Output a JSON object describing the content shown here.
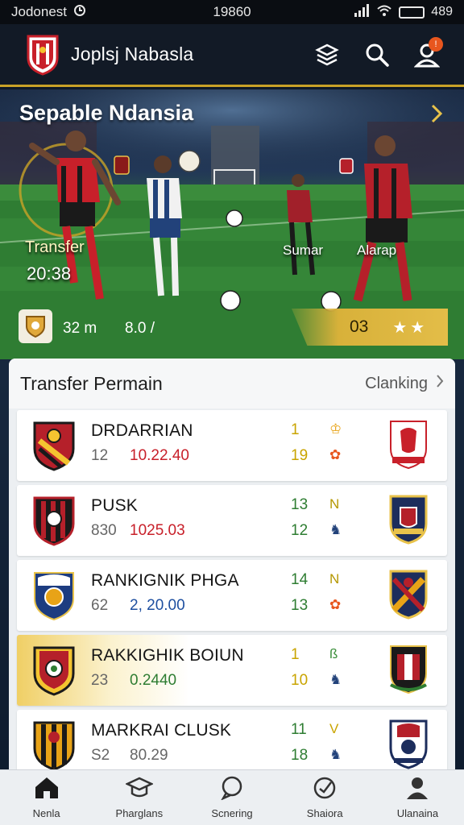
{
  "status_bar": {
    "carrier": "Jodonest",
    "time": "19860",
    "right_text": "489",
    "icons": [
      "signal-icon",
      "wifi-icon",
      "battery-icon"
    ]
  },
  "app_bar": {
    "title": "Joplsj Nabasla",
    "notification_count": "!",
    "icons": [
      "club-crest-icon",
      "box-icon",
      "search-icon",
      "profile-icon"
    ]
  },
  "hero": {
    "title": "Sepable Ndansia",
    "label_transfer": "Transfer",
    "label_time": "20:38",
    "label_player_a": "Sumar",
    "label_player_b": "Alarap",
    "stat_one": "32 m",
    "stat_two": "8.0 /",
    "score": "03",
    "stars": "★★"
  },
  "transfer_card": {
    "title": "Transfer Permain",
    "link": "Clanking",
    "rows": [
      {
        "name": "DRDARRIAN",
        "sub": "12",
        "price": "10.22.40",
        "s1": "1",
        "s2": "19",
        "mark1": "♔",
        "mark2": "✿",
        "price_color": "#c8202a",
        "s_color": "#c9a400",
        "m1_color": "#e8a317",
        "m2_color": "#e8561e"
      },
      {
        "name": "PUSK",
        "sub": "830",
        "price": "1025.03",
        "s1": "13",
        "s2": "12",
        "mark1": "N",
        "mark2": "♞",
        "price_color": "#c8202a",
        "s_color": "#2e7d32",
        "m1_color": "#b49700",
        "m2_color": "#22427a"
      },
      {
        "name": "RANKIGNIK PHGA",
        "sub": "62",
        "price": "2, 20.00",
        "s1": "14",
        "s2": "13",
        "mark1": "N",
        "mark2": "✿",
        "price_color": "#1e4fa0",
        "s_color": "#2e7d32",
        "m1_color": "#b49700",
        "m2_color": "#e8561e"
      },
      {
        "name": "RAKKIGHIK BOIUN",
        "sub": "23",
        "price": "0.2440",
        "s1": "1",
        "s2": "10",
        "mark1": "ß",
        "mark2": "♞",
        "price_color": "#2e7d32",
        "s_color": "#c9a400",
        "m1_color": "#3a8f3a",
        "m2_color": "#22427a"
      },
      {
        "name": "MARKRAI CLUSK",
        "sub": "S2",
        "price": "80.29",
        "s1": "11",
        "s2": "18",
        "mark1": "V",
        "mark2": "♞",
        "price_color": "#666666",
        "s_color": "#2e7d32",
        "m1_color": "#c9a400",
        "m2_color": "#22427a"
      }
    ]
  },
  "bottom_nav": [
    {
      "label": "Nenla",
      "icon": "home-icon"
    },
    {
      "label": "Pharglans",
      "icon": "graduation-cap-icon"
    },
    {
      "label": "Scnering",
      "icon": "chat-bubble-icon"
    },
    {
      "label": "Shaiora",
      "icon": "check-circle-icon"
    },
    {
      "label": "Ulanaina",
      "icon": "user-icon"
    }
  ]
}
